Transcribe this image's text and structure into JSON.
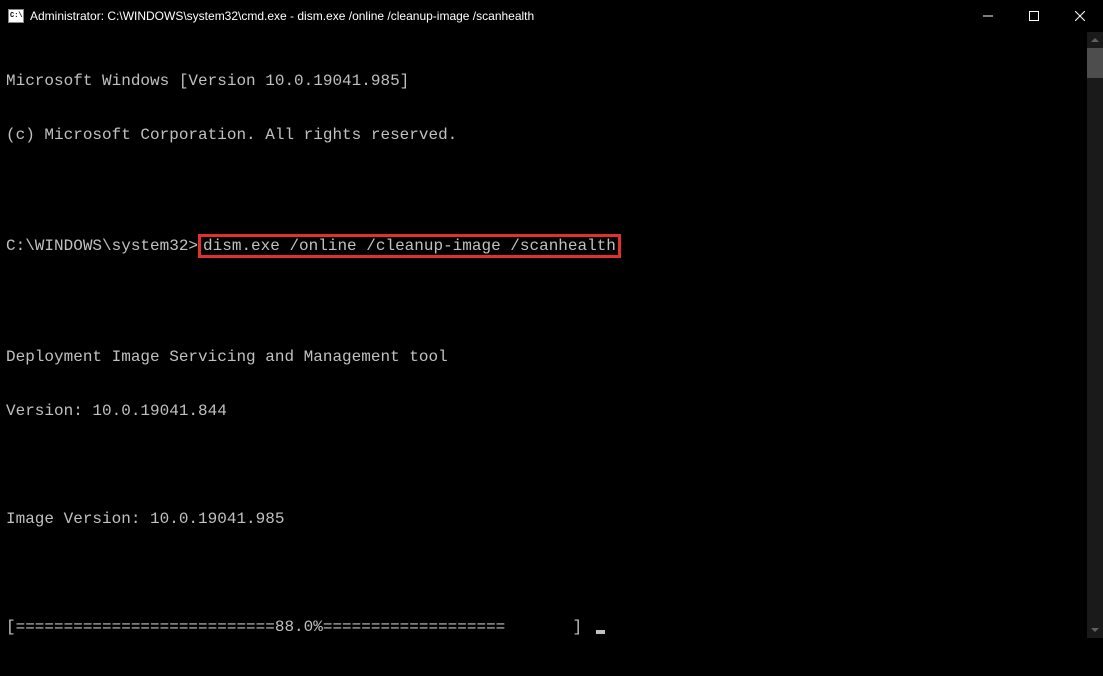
{
  "titlebar": {
    "icon_text": "C:\\.",
    "title": "Administrator: C:\\WINDOWS\\system32\\cmd.exe - dism.exe  /online /cleanup-image /scanhealth"
  },
  "terminal": {
    "line1": "Microsoft Windows [Version 10.0.19041.985]",
    "line2": "(c) Microsoft Corporation. All rights reserved.",
    "blank": "",
    "prompt": "C:\\WINDOWS\\system32>",
    "command": "dism.exe /online /cleanup-image /scanhealth",
    "tool_line1": "Deployment Image Servicing and Management tool",
    "tool_line2": "Version: 10.0.19041.844",
    "image_version": "Image Version: 10.0.19041.985",
    "progress": "[===========================88.0%===================       ] "
  }
}
